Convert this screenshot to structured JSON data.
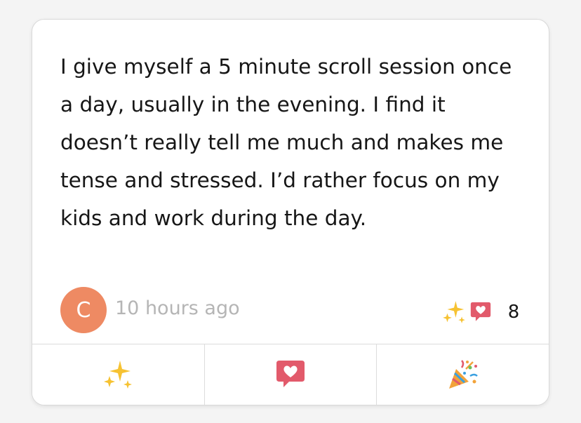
{
  "post": {
    "text": "I give myself a 5 minute scroll session once a day, usually in the evening. I find it doesn’t really tell me much and makes me tense and stressed. I’d rather focus on my kids and work during the day."
  },
  "author": {
    "initial": "C",
    "avatar_color": "#ee8a63",
    "timestamp": "10 hours ago"
  },
  "reactions": {
    "icons": [
      "sparkles-icon",
      "heart-speech-bubble-icon"
    ],
    "count": "8"
  },
  "actions": [
    {
      "name": "sparkles-react-button",
      "icon": "sparkles-icon"
    },
    {
      "name": "heart-react-button",
      "icon": "heart-speech-bubble-icon"
    },
    {
      "name": "celebrate-react-button",
      "icon": "party-popper-icon"
    }
  ],
  "colors": {
    "sparkle": "#f6c232",
    "heart_bubble": "#e25a6b",
    "popper_cone": "#f2a33a"
  }
}
